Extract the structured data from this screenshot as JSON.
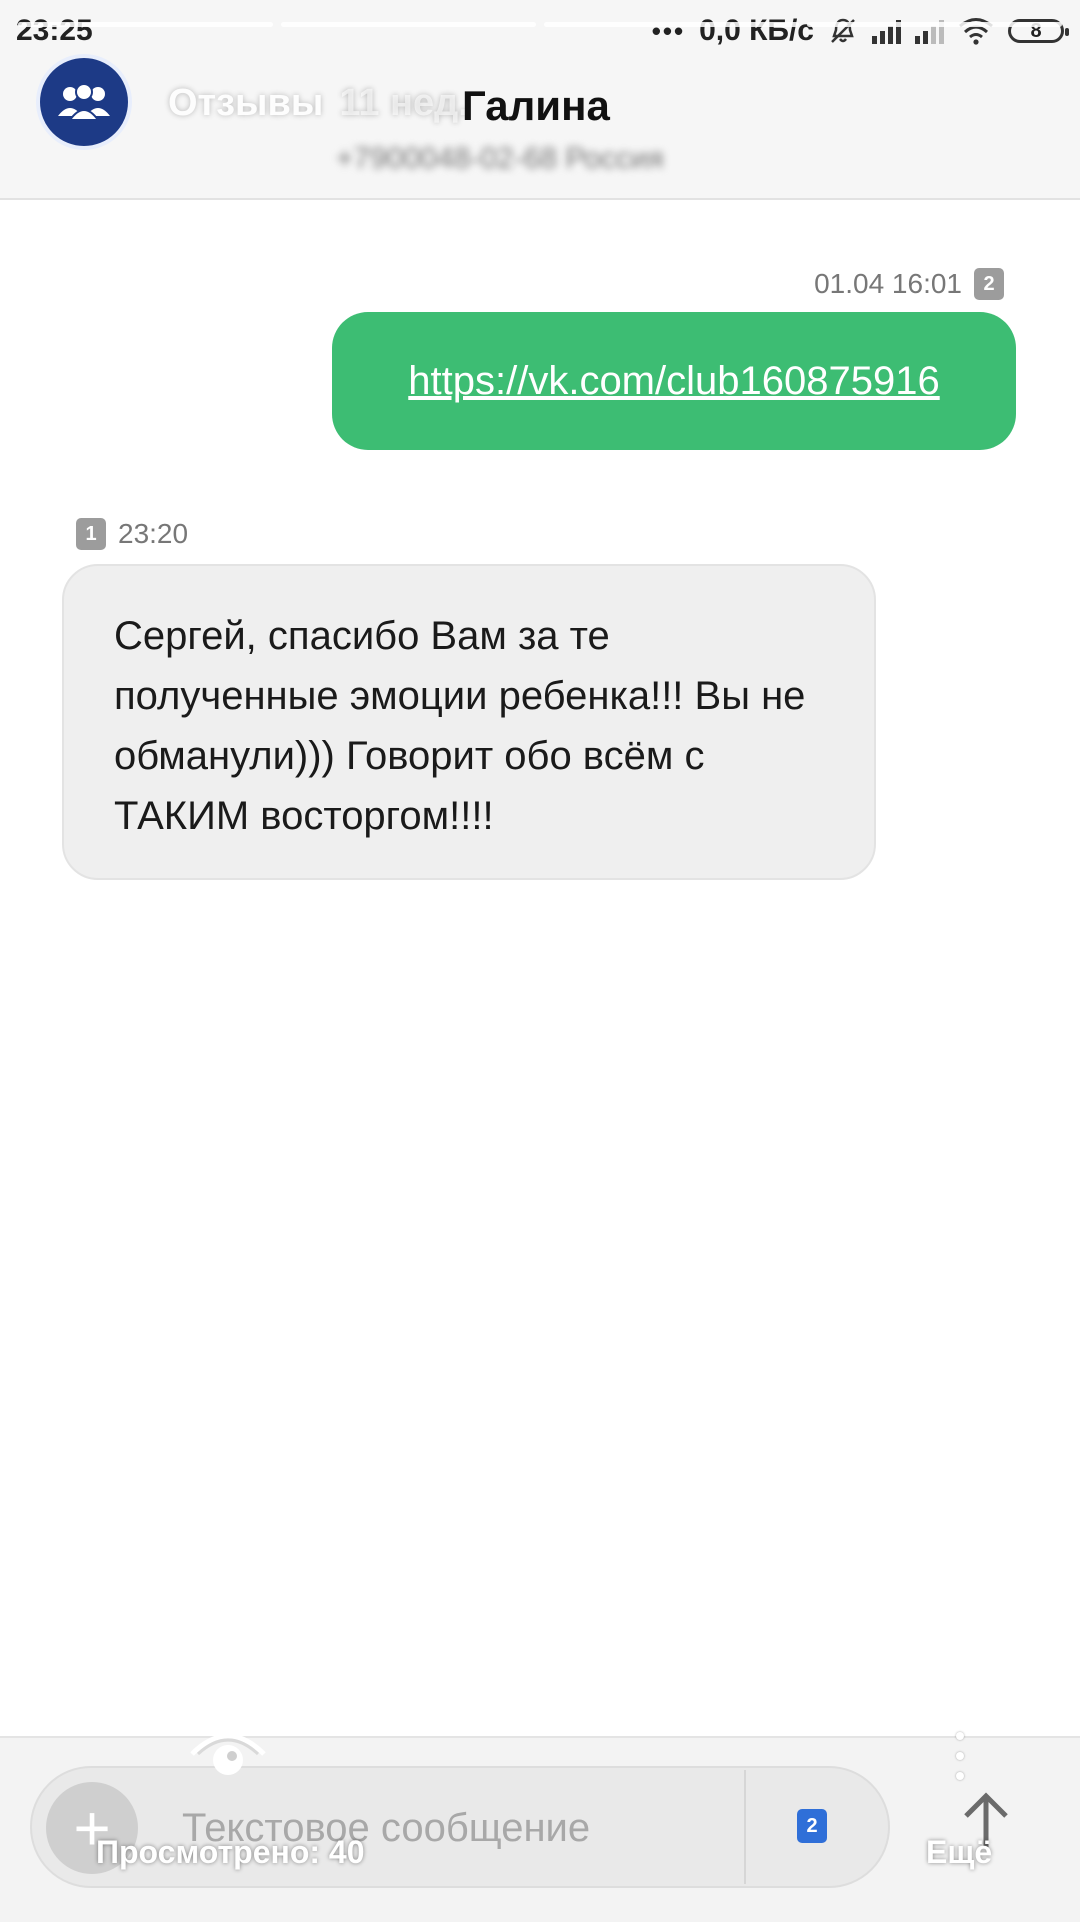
{
  "status_bar": {
    "time": "23:25",
    "dots": "•••",
    "network_speed": "0,0 КБ/с",
    "battery": "8"
  },
  "story": {
    "title": "Отзывы",
    "age": "11 нед.",
    "segments": 4
  },
  "conversation": {
    "contact_name": "Галина",
    "contact_phone": "+7900048-02-68 Россия"
  },
  "messages": [
    {
      "direction": "outgoing",
      "time": "01.04 16:01",
      "sim": "2",
      "text": "https://vk.com/club160875916"
    },
    {
      "direction": "incoming",
      "time": "23:20",
      "sim": "1",
      "text": "Сергей, спасибо Вам за те полученные эмоции ребенка!!! Вы не обманули))) Говорит обо всём с ТАКИМ восторгом!!!!"
    }
  ],
  "composer": {
    "plus": "+",
    "placeholder": "Текстовое сообщение",
    "sim": "2"
  },
  "overlay": {
    "viewed": "Просмотрено: 40",
    "more": "Ещё"
  },
  "colors": {
    "outgoing_bubble": "#3dbd73",
    "incoming_bubble": "#efefef",
    "avatar_bg": "#1d3a86",
    "sim_badge": "#9c9c9c",
    "sim_send": "#2f6fd8"
  },
  "icons": [
    "eye-icon",
    "send-arrow-icon",
    "more-vertical-icon",
    "wifi-icon",
    "signal-icon",
    "mute-bell-icon",
    "battery-icon"
  ]
}
